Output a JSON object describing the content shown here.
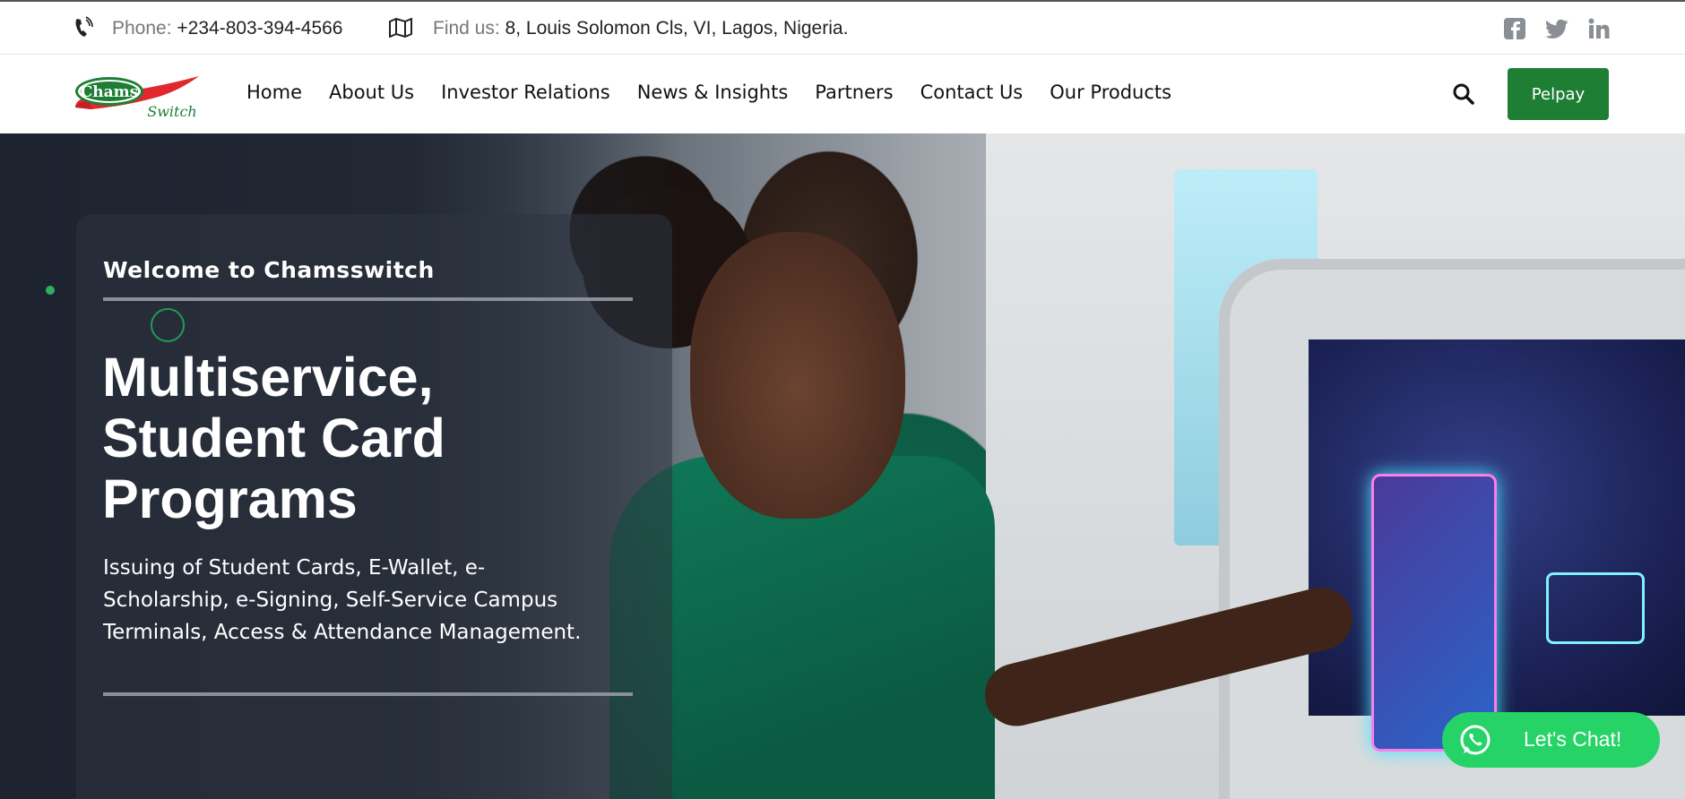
{
  "topbar": {
    "phone_label": "Phone:",
    "phone_value": "+234-803-394-4566",
    "location_label": "Find us:",
    "location_value": "8, Louis Solomon Cls, VI, Lagos, Nigeria.",
    "social_icons": [
      "facebook-icon",
      "twitter-icon",
      "linkedin-icon"
    ]
  },
  "brand": {
    "logo_text_top": "Chams",
    "logo_text_bottom": "Switch",
    "primary_color": "#1e7e34",
    "accent_color": "#e0282e"
  },
  "nav": {
    "items": [
      "Home",
      "About Us",
      "Investor Relations",
      "News & Insights",
      "Partners",
      "Contact Us",
      "Our Products"
    ],
    "cta_label": "Pelpay"
  },
  "hero": {
    "welcome": "Welcome to Chamsswitch",
    "headline_line1": "Multiservice,",
    "headline_line2": "Student Card",
    "headline_line3": "Programs",
    "description": "Issuing of Student Cards, E-Wallet, e-Scholarship, e-Signing, Self-Service Campus Terminals, Access & Attendance Management."
  },
  "chat": {
    "label": "Let's Chat!",
    "color": "#25d366"
  }
}
